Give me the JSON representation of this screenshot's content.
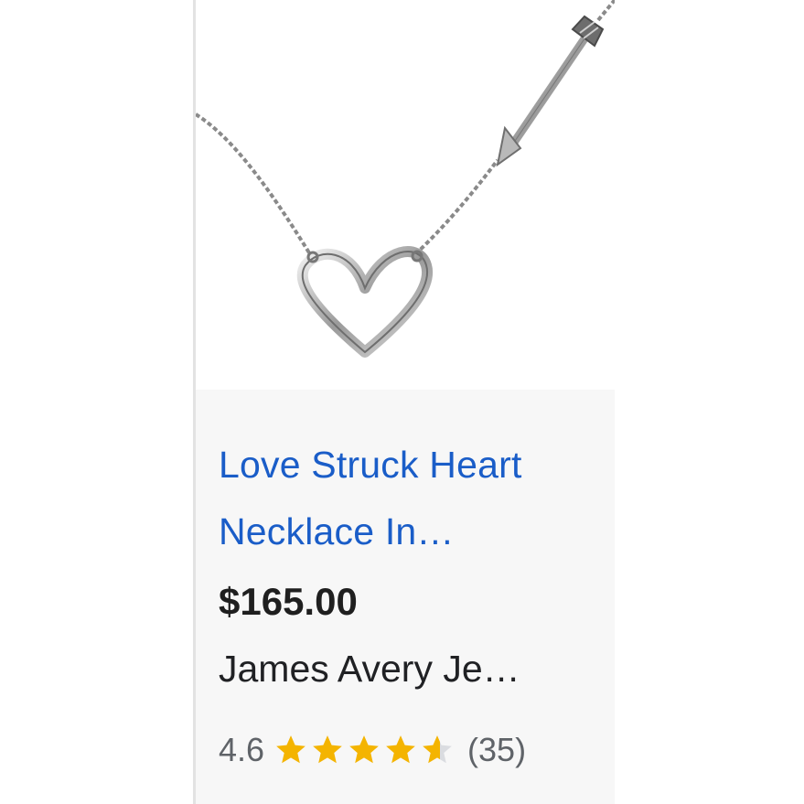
{
  "product": {
    "image_icon": "heart-necklace-with-arrow-photo",
    "title": "Love Struck Heart Necklace In…",
    "price": "$165.00",
    "seller": "James Avery Je…",
    "rating": "4.6",
    "rating_stars": 4.6,
    "review_count": "(35)"
  },
  "colors": {
    "link": "#1a5dc8",
    "star": "#f4b400",
    "star_empty": "#dadce0",
    "panel_bg": "#f7f7f7"
  }
}
